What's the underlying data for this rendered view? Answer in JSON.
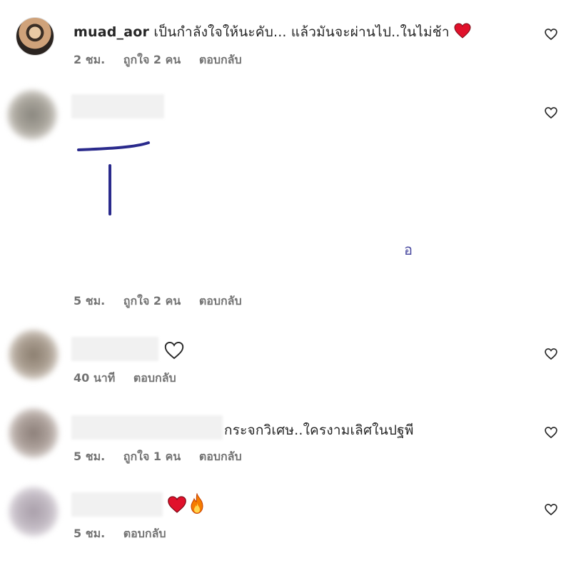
{
  "comments": [
    {
      "username": "muad_aor",
      "text": "เป็นกำลังใจให้นะคับ... แล้วมันจะผ่านไป..ในไม่ช้า",
      "time": "2 ชม.",
      "likes": "ถูกใจ 2 คน",
      "reply": "ตอบกลับ"
    },
    {
      "username": "",
      "drawing_text": "อ",
      "time": "5 ชม.",
      "likes": "ถูกใจ 2 คน",
      "reply": "ตอบกลับ"
    },
    {
      "username": "",
      "time": "40 นาที",
      "reply": "ตอบกลับ"
    },
    {
      "username": "",
      "text": "กระจกวิเศษ..ใครงามเลิศในปฐพี",
      "time": "5 ชม.",
      "likes": "ถูกใจ 1 คน",
      "reply": "ตอบกลับ"
    },
    {
      "username": "",
      "time": "5 ชม.",
      "reply": "ตอบกลับ"
    }
  ],
  "icons": {
    "like": "heart-outline-icon",
    "red_heart": "red-heart-emoji",
    "fire": "fire-emoji",
    "white_heart": "white-heart-emoji"
  },
  "colors": {
    "meta": "#737373",
    "text": "#262626",
    "red_heart": "#e0112b",
    "drawing_ink": "#2a2a8c"
  }
}
